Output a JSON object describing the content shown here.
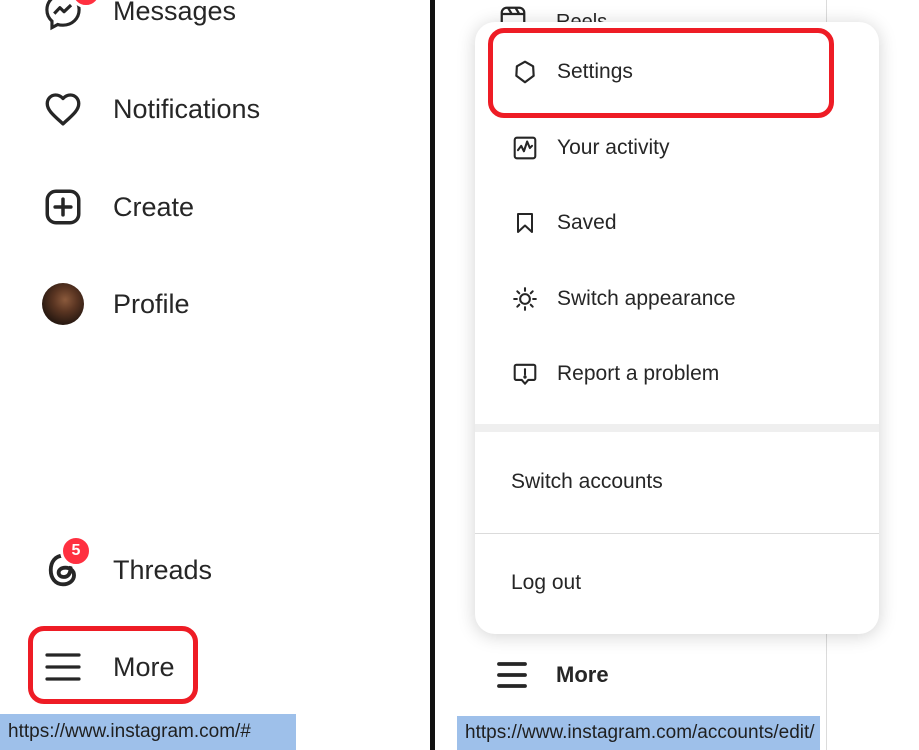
{
  "left_nav": {
    "messages_label": "Messages",
    "notifications_label": "Notifications",
    "create_label": "Create",
    "profile_label": "Profile",
    "threads_label": "Threads",
    "threads_badge": "5",
    "more_label": "More"
  },
  "left_status": {
    "url": "https://www.instagram.com/#"
  },
  "right_nav": {
    "reels_label": "Reels",
    "more_label": "More"
  },
  "more_menu": {
    "items": [
      {
        "label": "Settings",
        "icon": "settings-icon"
      },
      {
        "label": "Your activity",
        "icon": "activity-icon"
      },
      {
        "label": "Saved",
        "icon": "bookmark-icon"
      },
      {
        "label": "Switch appearance",
        "icon": "sun-icon"
      },
      {
        "label": "Report a problem",
        "icon": "report-icon"
      }
    ],
    "switch_accounts": "Switch accounts",
    "log_out": "Log out"
  },
  "right_status": {
    "url": "https://www.instagram.com/accounts/edit/"
  },
  "colors": {
    "highlight": "#ee1c25",
    "badge": "#ff3040",
    "status_bar": "#9ec0ea"
  }
}
